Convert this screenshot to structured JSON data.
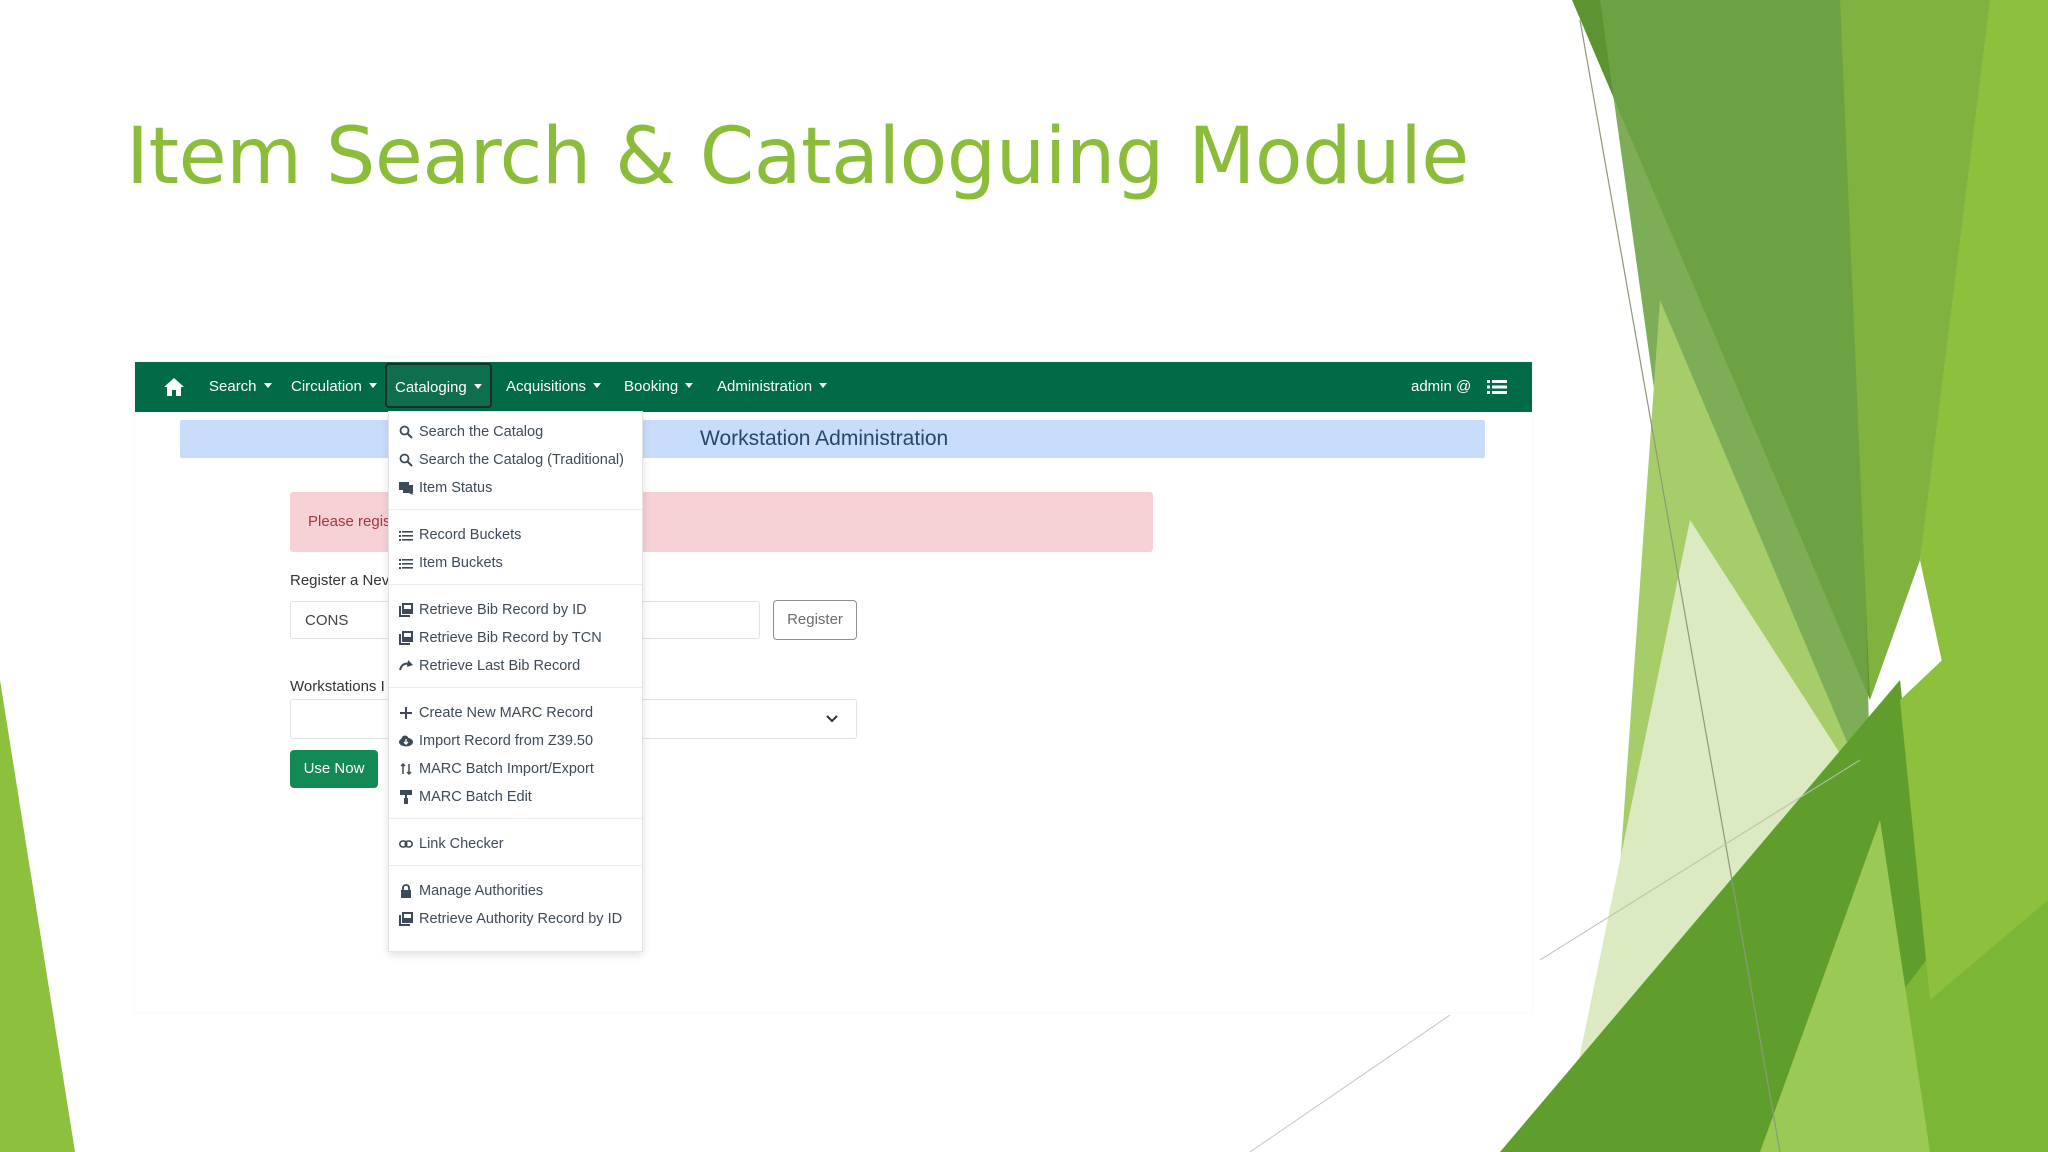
{
  "slide": {
    "title": "Item Search & Cataloguing Module"
  },
  "navbar": {
    "items": [
      {
        "label": "Search"
      },
      {
        "label": "Circulation"
      },
      {
        "label": "Cataloging"
      },
      {
        "label": "Acquisitions"
      },
      {
        "label": "Booking"
      },
      {
        "label": "Administration"
      }
    ],
    "user": "admin @",
    "icons": [
      "home-icon",
      "list-icon"
    ]
  },
  "page": {
    "header": "Workstation Administration",
    "alert": "Please regis",
    "register_label": "Register a Nev",
    "register_input_value": "CONS",
    "register_button": "Register",
    "workstations_label": "Workstations I",
    "use_now_button": "Use Now"
  },
  "cataloging_menu": {
    "items": [
      {
        "label": "Search the Catalog",
        "icon": "search-icon"
      },
      {
        "label": "Search the Catalog (Traditional)",
        "icon": "search-icon"
      },
      {
        "label": "Item Status",
        "icon": "comments-icon"
      },
      {
        "label": "Record Buckets",
        "icon": "list-icon"
      },
      {
        "label": "Item Buckets",
        "icon": "list-icon"
      },
      {
        "label": "Retrieve Bib Record by ID",
        "icon": "book-stack-icon"
      },
      {
        "label": "Retrieve Bib Record by TCN",
        "icon": "book-stack-icon"
      },
      {
        "label": "Retrieve Last Bib Record",
        "icon": "redo-arrow-icon"
      },
      {
        "label": "Create New MARC Record",
        "icon": "plus-icon"
      },
      {
        "label": "Import Record from Z39.50",
        "icon": "cloud-download-icon"
      },
      {
        "label": "MARC Batch Import/Export",
        "icon": "sort-arrows-icon"
      },
      {
        "label": "MARC Batch Edit",
        "icon": "paint-roller-icon"
      },
      {
        "label": "Link Checker",
        "icon": "link-icon"
      },
      {
        "label": "Manage Authorities",
        "icon": "lock-icon"
      },
      {
        "label": "Retrieve Authority Record by ID",
        "icon": "book-stack-icon"
      }
    ]
  },
  "colors": {
    "navbar": "#006b46",
    "slide_title": "#8cbd3a",
    "header_bg": "#c7ddfb",
    "alert_bg": "#f6d2d7",
    "primary_button": "#138a55"
  }
}
